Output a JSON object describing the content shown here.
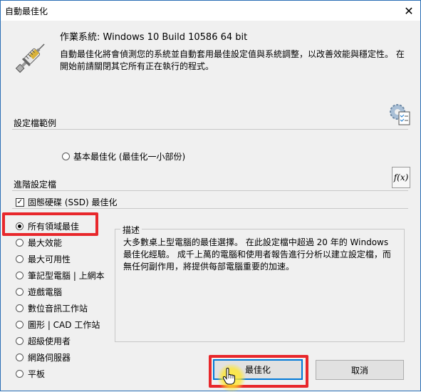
{
  "window": {
    "title": "自動最佳化"
  },
  "header": {
    "os_line": "作業系統: Windows 10 Build 10586 64 bit",
    "intro": "自動最佳化將會偵測您的系統並自動套用最佳設定值與系統調整，以改善效能與穩定性。 在開始前請關閉其它所有正在執行的程式。"
  },
  "profile_section": {
    "label": "設定檔範例",
    "basic_option": "基本最佳化 (最佳化一小部份)"
  },
  "advanced_section": {
    "label": "進階設定檔",
    "ssd_checkbox": "固態硬碟 (SSD) 最佳化",
    "ssd_checked": true,
    "fx_button": "f(x)",
    "options": [
      {
        "label": "所有領域最佳",
        "selected": true
      },
      {
        "label": "最大效能",
        "selected": false
      },
      {
        "label": "最大可用性",
        "selected": false
      },
      {
        "label": "筆記型電腦 | 上網本",
        "selected": false
      },
      {
        "label": "遊戲電腦",
        "selected": false
      },
      {
        "label": "數位音訊工作站",
        "selected": false
      },
      {
        "label": "圖形 | CAD 工作站",
        "selected": false
      },
      {
        "label": "超級使用者",
        "selected": false
      },
      {
        "label": "網路伺服器",
        "selected": false
      },
      {
        "label": "平板",
        "selected": false
      }
    ]
  },
  "description": {
    "title": "描述",
    "text": "大多數桌上型電腦的最佳選擇。 在此設定檔中超過 20 年的 Windows 最佳化經驗。 成千上萬的電腦和使用者報告進行分析以建立設定檔，而無任何副作用，將提供每部電腦重要的加速。"
  },
  "buttons": {
    "optimize": "最佳化",
    "cancel": "取消"
  },
  "highlight_color": "#e8272b",
  "icons": {
    "syringe": "syringe-icon",
    "gear_checklist": "gear-checklist-icon",
    "close": "close-icon",
    "cursor": "hand-cursor-icon"
  }
}
